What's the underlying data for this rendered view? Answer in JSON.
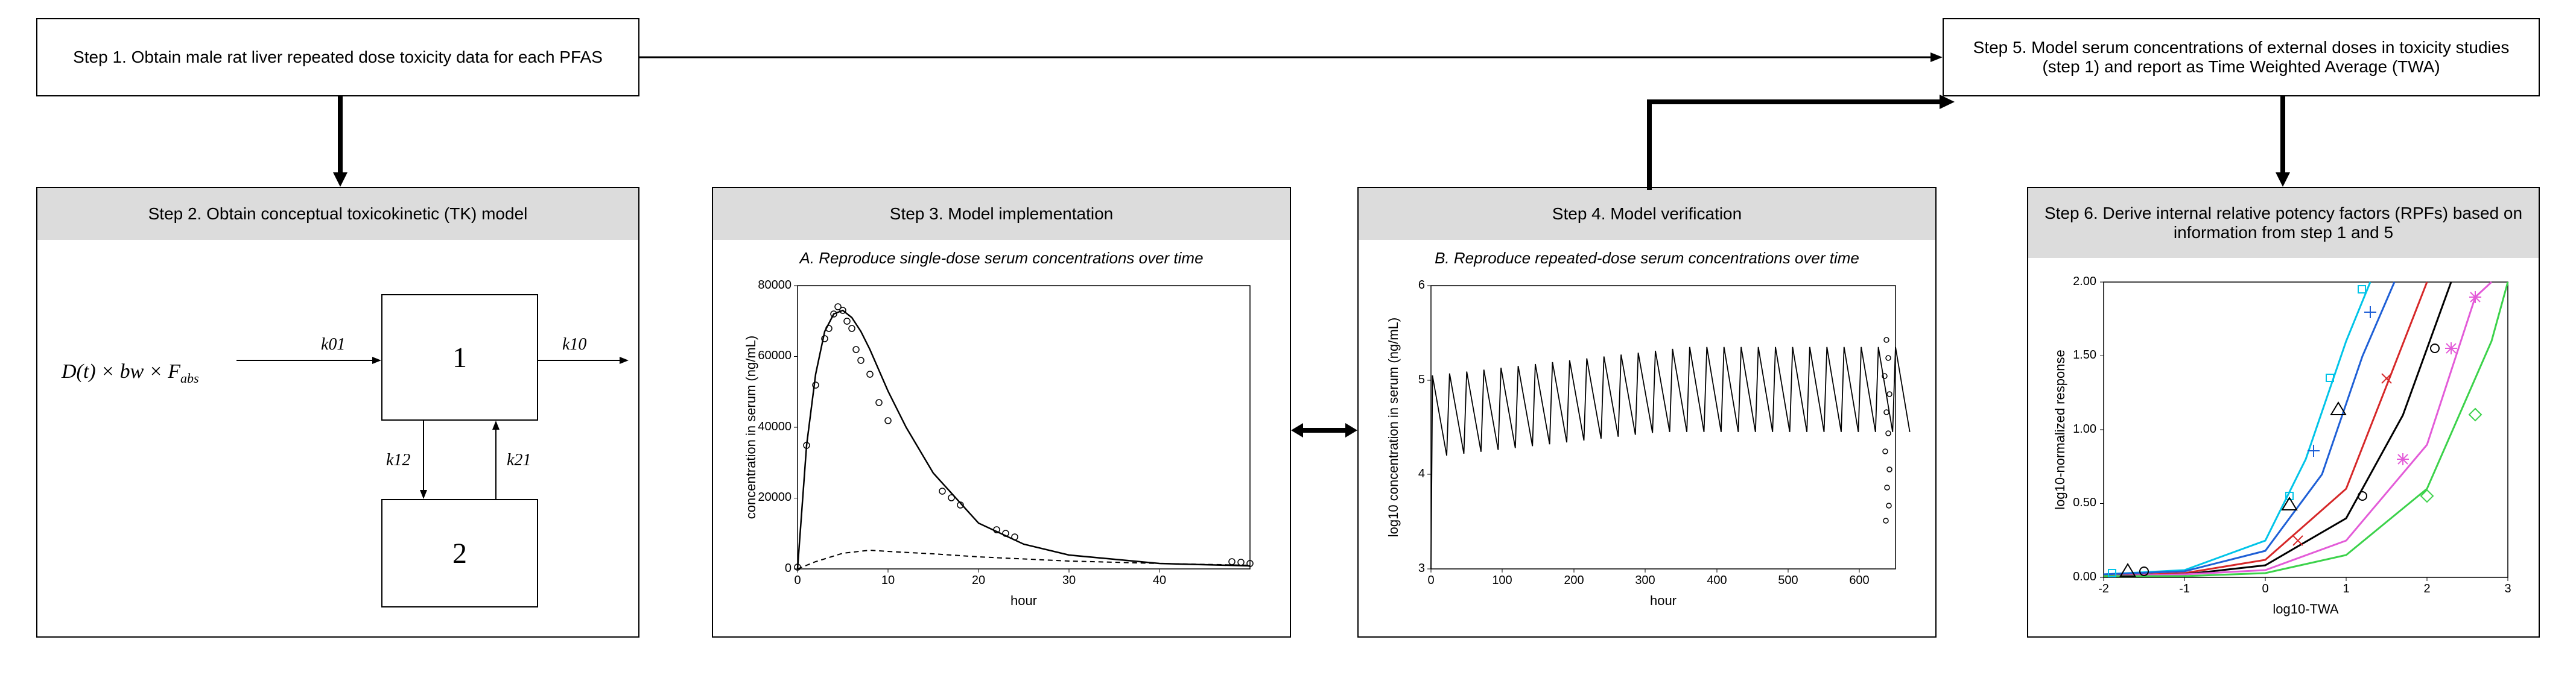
{
  "steps": {
    "s1": "Step 1. Obtain male rat liver repeated dose toxicity data for each PFAS",
    "s2": "Step 2. Obtain conceptual toxicokinetic (TK) model",
    "s3": "Step 3. Model implementation",
    "s4": "Step 4. Model verification",
    "s5": "Step 5. Model serum concentrations of external doses in toxicity studies (step 1) and report as Time Weighted Average (TWA)",
    "s6": "Step 6. Derive internal relative potency factors (RPFs) based on information from step 1 and 5"
  },
  "tk_model": {
    "input_formula": "D(t) × bw × F",
    "input_sub": "abs",
    "k01": "k01",
    "k10": "k10",
    "k12": "k12",
    "k21": "k21",
    "compartment1": "1",
    "compartment2": "2"
  },
  "chartA": {
    "title": "A. Reproduce single-dose serum concentrations over time",
    "xlabel": "hour",
    "ylabel": "concentration in serum (ng/mL)"
  },
  "chartB": {
    "title": "B. Reproduce repeated-dose serum concentrations over time",
    "xlabel": "hour",
    "ylabel": "log10 concentration in serum (ng/mL)"
  },
  "chartC": {
    "xlabel": "log10-TWA",
    "ylabel": "log10-normalized response"
  },
  "chart_data": [
    {
      "type": "scatter-line",
      "name": "chartA",
      "title": "A. Reproduce single-dose serum concentrations over time",
      "xlabel": "hour",
      "ylabel": "concentration in serum (ng/mL)",
      "xlim": [
        0,
        50
      ],
      "ylim": [
        0,
        80000
      ],
      "x_ticks": [
        0,
        10,
        20,
        30,
        40
      ],
      "y_ticks": [
        0,
        20000,
        40000,
        60000,
        80000
      ],
      "series": [
        {
          "name": "fit-main",
          "style": "line-solid",
          "x": [
            0,
            1,
            2,
            3,
            4,
            5,
            6,
            7,
            8,
            10,
            12,
            15,
            20,
            25,
            30,
            40,
            50
          ],
          "y": [
            0,
            35000,
            55000,
            67000,
            72000,
            73000,
            71000,
            67000,
            62000,
            50000,
            40000,
            27000,
            13000,
            7000,
            4000,
            1500,
            800
          ]
        },
        {
          "name": "observed",
          "style": "points-circle",
          "x": [
            0,
            1,
            2,
            3,
            3.5,
            4,
            4.5,
            5,
            5.5,
            6,
            6.5,
            7,
            8,
            9,
            10,
            16,
            17,
            18,
            22,
            23,
            24,
            48,
            49,
            50
          ],
          "y": [
            500,
            35000,
            52000,
            65000,
            68000,
            72000,
            74000,
            73000,
            70000,
            68000,
            62000,
            59000,
            55000,
            47000,
            42000,
            22000,
            20000,
            18000,
            11000,
            10000,
            9000,
            2000,
            1800,
            1600
          ]
        },
        {
          "name": "fit-secondary",
          "style": "line-dashed",
          "x": [
            0,
            2,
            5,
            8,
            10,
            15,
            20,
            30,
            40,
            50
          ],
          "y": [
            0,
            2000,
            4500,
            5200,
            5000,
            4200,
            3400,
            2200,
            1500,
            1000
          ]
        }
      ]
    },
    {
      "type": "line",
      "name": "chartB",
      "title": "B. Reproduce repeated-dose serum concentrations over time",
      "xlabel": "hour",
      "ylabel": "log10 concentration in serum (ng/mL)",
      "xlim": [
        0,
        650
      ],
      "ylim": [
        3,
        6
      ],
      "x_ticks": [
        0,
        100,
        200,
        300,
        400,
        500,
        600
      ],
      "y_ticks": [
        3,
        4,
        5,
        6
      ],
      "notes": "Oscillating repeated-dose profile, ~28 dosing cycles, trough ~4.2, peak ~5.3 on log10 scale; cluster of observed points near t≈640 between 3.5 and 5.5"
    },
    {
      "type": "line-multi",
      "name": "chartC",
      "xlabel": "log10-TWA",
      "ylabel": "log10-normalized response",
      "xlim": [
        -2,
        3
      ],
      "ylim": [
        0,
        2.0
      ],
      "x_ticks": [
        -2,
        -1,
        0,
        1,
        2,
        3
      ],
      "y_ticks": [
        0.0,
        0.5,
        1.0,
        1.5,
        2.0
      ],
      "series": [
        {
          "name": "curve-cyan",
          "color": "#00c4e8",
          "x": [
            -2,
            -1,
            0,
            0.5,
            1,
            1.3,
            1.5
          ],
          "y": [
            0.02,
            0.05,
            0.25,
            0.8,
            1.6,
            2.0,
            2.0
          ]
        },
        {
          "name": "curve-blue",
          "color": "#1e5fd6",
          "x": [
            -2,
            -1,
            0,
            0.7,
            1.2,
            1.6,
            1.8
          ],
          "y": [
            0.02,
            0.04,
            0.18,
            0.7,
            1.5,
            2.0,
            2.0
          ]
        },
        {
          "name": "curve-red",
          "color": "#d62728",
          "x": [
            -2,
            -1,
            0,
            1,
            1.5,
            2,
            2.2
          ],
          "y": [
            0.01,
            0.03,
            0.12,
            0.6,
            1.3,
            2.0,
            2.0
          ]
        },
        {
          "name": "curve-black",
          "color": "#000000",
          "x": [
            -2,
            -1,
            0,
            1,
            1.7,
            2.3,
            2.5
          ],
          "y": [
            0.01,
            0.02,
            0.08,
            0.4,
            1.1,
            2.0,
            2.0
          ]
        },
        {
          "name": "curve-magenta",
          "color": "#e35bd8",
          "x": [
            -2,
            -1,
            0,
            1,
            2,
            2.6,
            2.8
          ],
          "y": [
            0.01,
            0.02,
            0.05,
            0.25,
            0.9,
            1.9,
            2.0
          ]
        },
        {
          "name": "curve-green",
          "color": "#3bd24a",
          "x": [
            -2,
            -1,
            0,
            1,
            2,
            2.8,
            3
          ],
          "y": [
            0.01,
            0.01,
            0.03,
            0.15,
            0.6,
            1.6,
            2.0
          ]
        }
      ],
      "points": [
        {
          "shape": "square",
          "color": "#00c4e8",
          "x": -1.9,
          "y": 0.03
        },
        {
          "shape": "square",
          "color": "#00c4e8",
          "x": 0.3,
          "y": 0.55
        },
        {
          "shape": "square",
          "color": "#00c4e8",
          "x": 0.8,
          "y": 1.35
        },
        {
          "shape": "square",
          "color": "#00c4e8",
          "x": 1.2,
          "y": 1.95
        },
        {
          "shape": "circle",
          "color": "#000",
          "x": -1.5,
          "y": 0.04
        },
        {
          "shape": "circle",
          "color": "#000",
          "x": 1.2,
          "y": 0.55
        },
        {
          "shape": "circle",
          "color": "#000",
          "x": 2.1,
          "y": 1.55
        },
        {
          "shape": "triangle",
          "color": "#000",
          "x": -1.7,
          "y": 0.05
        },
        {
          "shape": "triangle",
          "color": "#000",
          "x": 0.3,
          "y": 0.5
        },
        {
          "shape": "triangle",
          "color": "#000",
          "x": 0.9,
          "y": 1.15
        },
        {
          "shape": "plus",
          "color": "#1e5fd6",
          "x": 1.3,
          "y": 1.8
        },
        {
          "shape": "plus",
          "color": "#1e5fd6",
          "x": 0.6,
          "y": 0.9
        },
        {
          "shape": "x",
          "color": "#d62728",
          "x": 0.4,
          "y": 0.25
        },
        {
          "shape": "x",
          "color": "#d62728",
          "x": 1.5,
          "y": 1.35
        },
        {
          "shape": "star",
          "color": "#e35bd8",
          "x": 1.7,
          "y": 0.8
        },
        {
          "shape": "star",
          "color": "#e35bd8",
          "x": 2.3,
          "y": 1.55
        },
        {
          "shape": "star",
          "color": "#e35bd8",
          "x": 2.6,
          "y": 1.9
        },
        {
          "shape": "diamond",
          "color": "#3bd24a",
          "x": 2.0,
          "y": 0.55
        },
        {
          "shape": "diamond",
          "color": "#3bd24a",
          "x": 2.6,
          "y": 1.1
        }
      ]
    }
  ]
}
